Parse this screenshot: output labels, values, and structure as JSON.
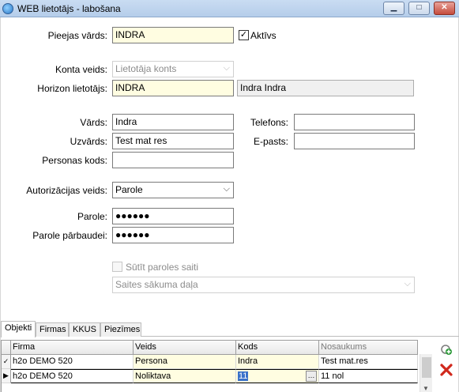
{
  "window": {
    "title": "WEB lietotājs - labošana",
    "minimize_glyph": "▁",
    "maximize_glyph": "□",
    "close_glyph": "✕"
  },
  "form": {
    "access_name": {
      "label": "Pieejas vārds:",
      "value": "INDRA"
    },
    "active": {
      "label": "Aktīvs",
      "checked": true
    },
    "account_type": {
      "label": "Konta veids:",
      "value": "Lietotāja konts"
    },
    "horizon_user": {
      "label": "Horizon lietotājs:",
      "value": "INDRA",
      "display_name": "Indra Indra"
    },
    "first_name": {
      "label": "Vārds:",
      "value": "Indra"
    },
    "last_name": {
      "label": "Uzvārds:",
      "value": "Test mat res"
    },
    "personal_code": {
      "label": "Personas kods:",
      "value": ""
    },
    "phone": {
      "label": "Telefons:",
      "value": ""
    },
    "email": {
      "label": "E-pasts:",
      "value": ""
    },
    "auth_type": {
      "label": "Autorizācijas veids:",
      "value": "Parole"
    },
    "password": {
      "label": "Parole:",
      "value": "●●●●●●"
    },
    "password_confirm": {
      "label": "Parole pārbaudei:",
      "value": "●●●●●●"
    },
    "send_password_link": {
      "label": "Sūtīt paroles saiti",
      "checked": false
    },
    "site_start_page": {
      "value": "Saites sākuma daļa"
    }
  },
  "tabs": [
    {
      "label": "Objekti",
      "active": true
    },
    {
      "label": "Firmas",
      "active": false
    },
    {
      "label": "KKUS",
      "active": false
    },
    {
      "label": "Piezīmes",
      "active": false
    }
  ],
  "grid": {
    "columns": [
      "Firma",
      "Veids",
      "Kods",
      "Nosaukums"
    ],
    "rows": [
      {
        "marker": "✓",
        "firma": "h2o DEMO 520",
        "veids": "Persona",
        "kods": "Indra",
        "nosaukums": "Test mat.res"
      },
      {
        "marker": "▶",
        "firma": "h2o DEMO 520",
        "veids": "Noliktava",
        "kods": "11",
        "nosaukums": "11 nol"
      }
    ],
    "ellipsis": "…"
  },
  "side_actions": {
    "add_icon": "add-object-icon",
    "delete_icon": "delete-icon"
  },
  "colors": {
    "required_field": "#fffde1",
    "selection": "#3a72c9",
    "delete_red": "#d0281c",
    "add_green": "#2e9a3a"
  }
}
